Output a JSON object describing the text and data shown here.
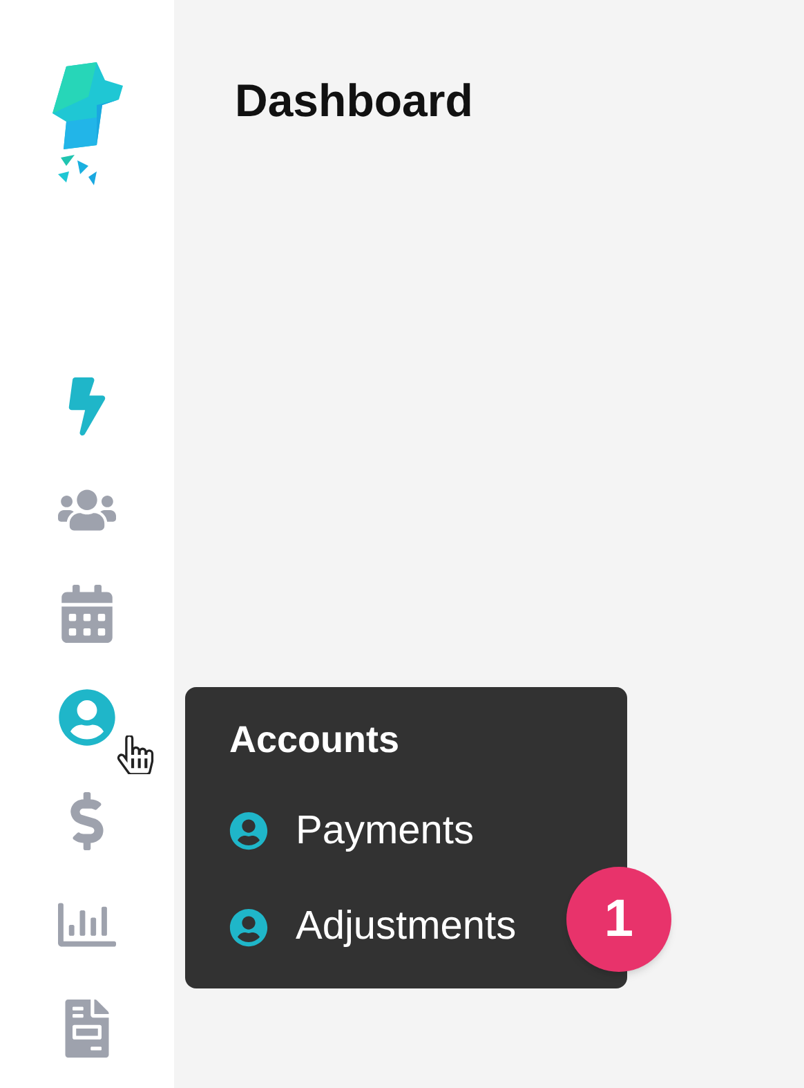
{
  "header": {
    "title": "Dashboard"
  },
  "sidebar": {
    "items": [
      {
        "kind": "bolt",
        "active": true
      },
      {
        "kind": "users",
        "active": false
      },
      {
        "kind": "calendar",
        "active": false
      },
      {
        "kind": "account",
        "active": true
      },
      {
        "kind": "dollar",
        "active": false
      },
      {
        "kind": "chart",
        "active": false
      },
      {
        "kind": "document",
        "active": false
      }
    ]
  },
  "flyout": {
    "title": "Accounts",
    "items": [
      {
        "label": "Payments"
      },
      {
        "label": "Adjustments",
        "badge": "1"
      }
    ]
  }
}
